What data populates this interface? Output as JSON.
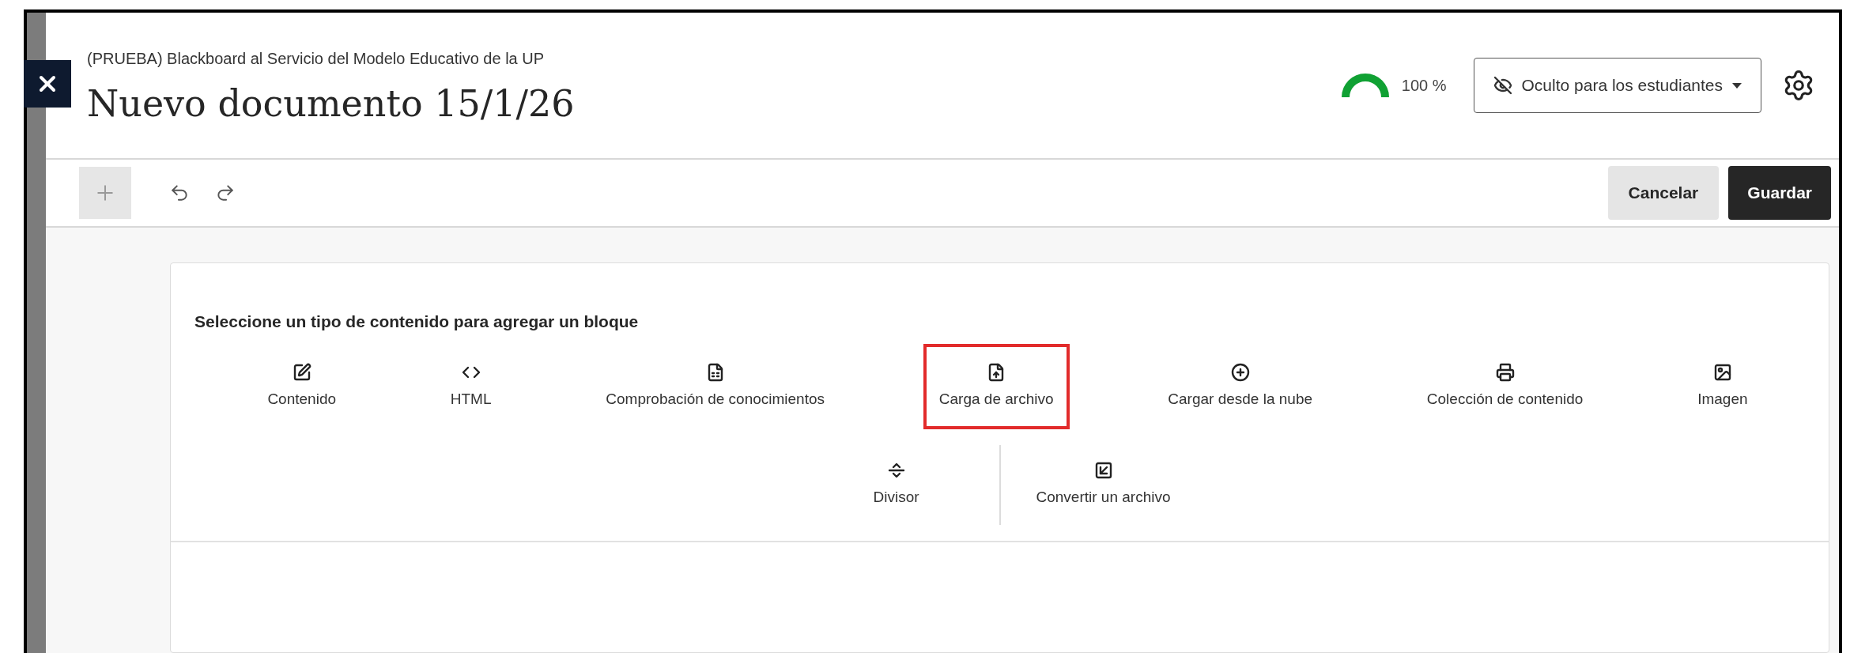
{
  "header": {
    "course": "(PRUEBA) Blackboard al Servicio del Modelo Educativo de la UP",
    "title": "Nuevo documento 15/1/26",
    "progress": {
      "level": 1,
      "reading": "100 %"
    },
    "visibility": "Oculto para los estudiantes"
  },
  "toolbar": {
    "add_disabled": true,
    "buttons": [
      "Cancelar",
      "Guardar"
    ]
  },
  "picker": {
    "heading": "Seleccione un tipo de contenido para agregar un bloque",
    "row_1": [
      {
        "label": "Contenido",
        "highlighted": false
      },
      {
        "label": "HTML",
        "highlighted": false
      },
      {
        "label": "Comprobación de conocimientos",
        "highlighted": false
      },
      {
        "label": "Carga de archivo",
        "highlighted": true
      },
      {
        "label": "Cargar desde la nube",
        "highlighted": false
      },
      {
        "label": "Colección de contenido",
        "highlighted": false
      },
      {
        "label": "Imagen",
        "highlighted": false
      }
    ],
    "row_2": [
      {
        "label": "Divisor",
        "highlighted": false
      },
      {
        "label": "Convertir un archivo",
        "highlighted": false
      }
    ]
  }
}
